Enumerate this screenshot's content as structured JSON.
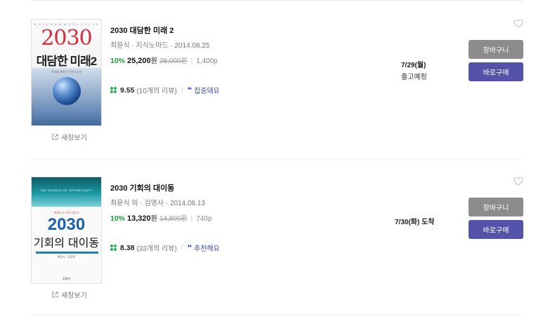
{
  "books": [
    {
      "title": "2030 대담한 미래 2",
      "meta": "최윤식 · 지식노마드 · 2014.08.25",
      "discount": "10%",
      "sale_price": "25,200",
      "won": "원",
      "orig_price": "28,000원",
      "pages": "1,400p",
      "score": "9.55",
      "reviews": "(10개의 리뷰)",
      "review_tag": "집중돼요",
      "delivery": "7/29(월)",
      "delivery_sub": "출고예정",
      "new_window": "새창보기",
      "cart": "장바구니",
      "buy": "바로구매",
      "cover": {
        "top": "B O L D   N E W   W O R L D   2 0 3 0",
        "year": "2030",
        "title": "대담한 미래2",
        "subtitle": "미래를 예측한 전략의 법칙"
      }
    },
    {
      "title": "2030 기회의 대이동",
      "meta": "최윤식 외 · 김영사 · 2014.08.13",
      "discount": "10%",
      "sale_price": "13,320",
      "won": "원",
      "orig_price": "14,800원",
      "pages": "740p",
      "score": "8.38",
      "reviews": "(33개의 리뷰)",
      "review_tag": "추천해요",
      "delivery": "7/30(화) 도착",
      "delivery_sub": "",
      "new_window": "새창보기",
      "cart": "장바구니",
      "buy": "바로구매",
      "cover": {
        "band": "THE EXODUS OF OPPORTUNITY",
        "pre": "미래는 누구의 것인가",
        "year": "2030",
        "title": "기회의 대이동",
        "author": "최윤식 · 김건주",
        "publisher": "김영사"
      }
    }
  ],
  "colors": {
    "discount": "#1a9e3a",
    "tag": "#3d4bb2",
    "buy": "#5552a9",
    "cart": "#8c8c8c",
    "clover": "#2bb24c"
  },
  "icons": [
    "heart-icon",
    "external-link-icon",
    "clover-icon",
    "quote-icon"
  ]
}
